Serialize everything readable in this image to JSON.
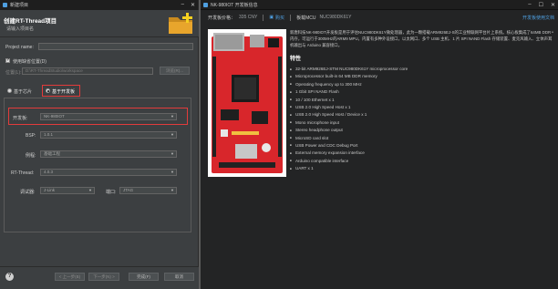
{
  "dialog": {
    "window_title": "新建项目",
    "heading": "创建RT-Thread项目",
    "subheading": "请输入项目名",
    "project_name_label": "Project name:",
    "project_name_value": "",
    "default_location_label": "使用缺省位置(D)",
    "location_label": "位置(L):",
    "location_value": "D:\\RT-ThreadStudio\\workspace",
    "browse_label": "浏览(R)...",
    "tab_chip": "基于芯片",
    "tab_board": "基于开发板",
    "board_label": "开发板:",
    "board_value": "NK-980IOT",
    "bsp_label": "BSP:",
    "bsp_value": "1.0.1",
    "example_label": "例程:",
    "example_value": "基础工程",
    "rtt_label": "RT-Thread:",
    "rtt_value": "4.0.3",
    "debugger_label": "调试器:",
    "debugger_value": "J-Link",
    "port_label": "端口:",
    "port_value": "JTAG",
    "back_btn": "< 上一步(B)",
    "next_btn": "下一步(N) >",
    "finish_btn": "完成(F)",
    "cancel_btn": "取消"
  },
  "board": {
    "window_title": "NK-980IOT 开发板信息",
    "price_label": "开发板价格：",
    "price_value": "335 CNY",
    "buy_link": "购买",
    "mcu_label": "板载MCU",
    "mcu_value": "NUC980DK61Y",
    "doc_link": "开发板使用文档",
    "description": "新唐科技NK-980IOT开发板是用于评估NUC980DK61Y微处理器，此为一颗搭载ARM926EJ-S的工业物联网平台片上系统。核心板集成了64MB DDR内存，可运行于300MHz的ARM9 MPU，内置有多种外设接口，以太网口、多个 USB 主机、1 片 SPI NAND Flash 存储装置、麦克风输入、立体声耳机输出与 Arduino 兼容接口。",
    "features_title": "特性",
    "features": [
      "32-bit ARM926EJ-STM NUC980DK61Y microprocessor core",
      "Microprocessor built-in 64 MB DDR memory",
      "Operating frequency up to 300 MHz",
      "1 Gbit SPI NAND Flash",
      "10 / 100 Ethernet x 1",
      "USB 2.0 High Speed Host x 1",
      "USB 2.0 High Speed Host / Device x 1",
      "Mono microphone input",
      "Stereo headphone output",
      "MicroSD card slot",
      "USB Power and CDC Debug Port",
      "External memory expansion interface",
      "Arduino compatible interface",
      "UART x 1"
    ]
  },
  "colors": {
    "highlight": "#e23b3b",
    "link": "#4e9fe0",
    "board_pcb": "#d8262b",
    "folder": "#e8a52c",
    "plus": "#f5d020"
  }
}
